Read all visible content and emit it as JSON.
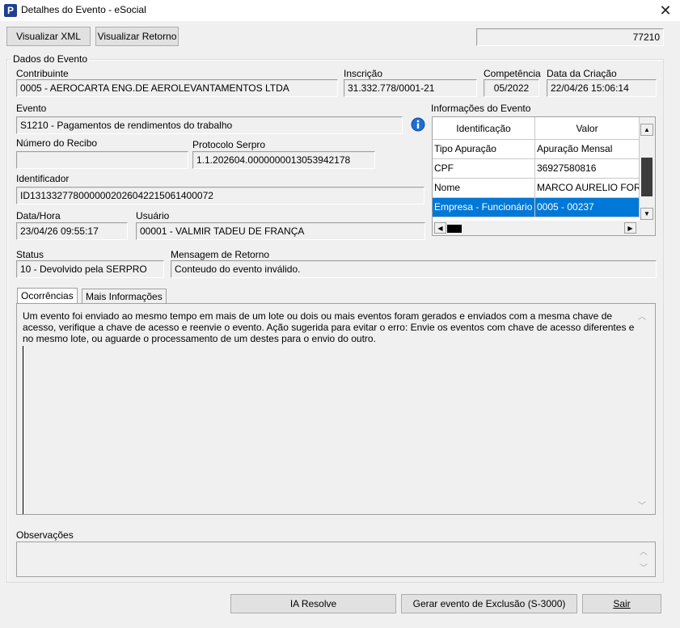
{
  "window": {
    "title": "Detalhes do Evento - eSocial",
    "app_icon_letter": "P",
    "close_glyph": "✕"
  },
  "toolbar": {
    "view_xml": "Visualizar XML",
    "view_return": "Visualizar Retorno",
    "counter": "77210"
  },
  "event_data": {
    "group_title": "Dados do Evento",
    "contribuinte_label": "Contribuinte",
    "contribuinte_value": "0005 - AEROCARTA  ENG.DE AEROLEVANTAMENTOS LTDA",
    "inscricao_label": "Inscrição",
    "inscricao_value": "31.332.778/0001-21",
    "competencia_label": "Competência",
    "competencia_value": "05/2022",
    "data_criacao_label": "Data da Criação",
    "data_criacao_value": "22/04/26 15:06:14",
    "evento_label": "Evento",
    "evento_value": "S1210 - Pagamentos de rendimentos do trabalho",
    "info_label": "Informações do Evento",
    "numero_recibo_label": "Número do Recibo",
    "numero_recibo_value": "",
    "protocolo_label": "Protocolo Serpro",
    "protocolo_value": "1.1.202604.0000000013053942178",
    "identificador_label": "Identificador",
    "identificador_value": "ID1313327780000002026042215061400072",
    "data_hora_label": "Data/Hora",
    "data_hora_value": "23/04/26 09:55:17",
    "usuario_label": "Usuário",
    "usuario_value": "00001 - VALMIR TADEU DE FRANÇA",
    "status_label": "Status",
    "status_value": "10 - Devolvido pela SERPRO",
    "mensagem_label": "Mensagem de Retorno",
    "mensagem_value": "Conteudo do evento inválido."
  },
  "info_grid": {
    "columns": [
      "Identificação",
      "Valor"
    ],
    "rows": [
      {
        "id": "Tipo Apuração",
        "valor": "Apuração Mensal"
      },
      {
        "id": "CPF",
        "valor": "36927580816"
      },
      {
        "id": "Nome",
        "valor": "MARCO AURELIO FORM"
      },
      {
        "id": "Empresa - Funcionário",
        "valor": "0005 - 00237"
      }
    ],
    "selected_row": 3
  },
  "tabs": {
    "ocorrencias": "Ocorrências",
    "mais_info": "Mais Informações"
  },
  "ocorrencias_text": "Um evento foi enviado ao mesmo tempo em mais de um lote ou dois ou mais eventos foram gerados e enviados com a mesma chave de acesso, verifique a chave de acesso e reenvie o evento. Ação sugerida para evitar o erro: Envie os eventos com chave de acesso diferentes e no mesmo lote, ou aguarde o processamento de um destes para o envio do outro.",
  "observacoes_label": "Observações",
  "observacoes_value": "",
  "footer": {
    "ia_resolve": "IA Resolve",
    "gerar_exclusao": "Gerar evento de Exclusão (S-3000)",
    "sair": "Sair"
  },
  "colors": {
    "selection": "#0078d7",
    "info_icon": "#1e6fd0"
  }
}
